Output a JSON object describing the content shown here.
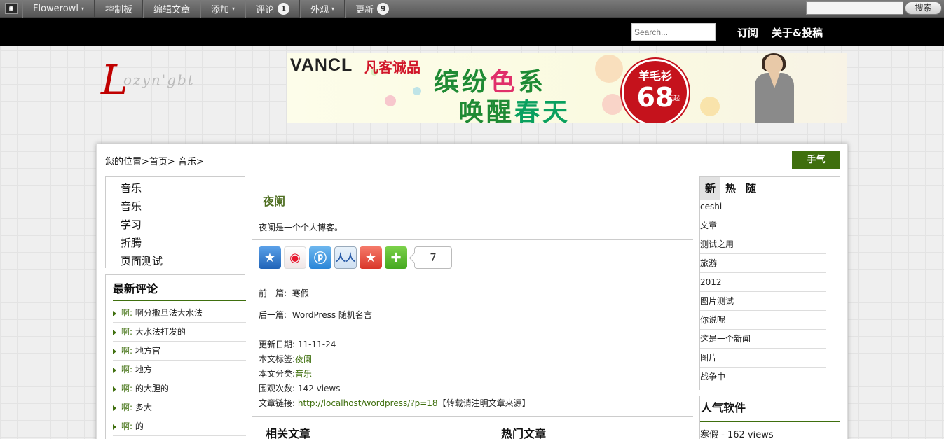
{
  "adminbar": {
    "items": [
      {
        "label": "Flowerowl",
        "caret": "▾"
      },
      {
        "label": "控制板"
      },
      {
        "label": "编辑文章"
      },
      {
        "label": "添加",
        "caret": "▾"
      },
      {
        "label": "评论",
        "count": "1"
      },
      {
        "label": "外观",
        "caret": "▾"
      },
      {
        "label": "更新",
        "count": "9"
      }
    ],
    "search_value": "",
    "search_button": "搜索"
  },
  "header": {
    "search_placeholder": "Search...",
    "links": [
      "订阅",
      "关于&投稿"
    ]
  },
  "logo": {
    "initial": "L",
    "rest": "ozyn'gbt"
  },
  "banner": {
    "brand": "VANCL",
    "brand_sub": "凡客诚品",
    "line1_a": "缤纷",
    "line1_b": "色",
    "line1_c": "系",
    "line2_a": "唤醒",
    "line2_b": "春天",
    "badge_title": "羊毛衫",
    "badge_price": "68",
    "badge_unit": "元起"
  },
  "breadcrumb": {
    "prefix": "您的位置>",
    "home": "首页",
    "sep": "> ",
    "cat": "音乐",
    "end": ">"
  },
  "phone_button": "手气",
  "categories": [
    "音乐",
    "音乐",
    "学习",
    "折腾",
    "页面测试"
  ],
  "recent_comments": {
    "title": "最新评论",
    "items": [
      {
        "who": "啊:",
        "text": " 啊分撒旦法大水法"
      },
      {
        "who": "啊:",
        "text": " 大水法打发的"
      },
      {
        "who": "啊:",
        "text": " 地方官"
      },
      {
        "who": "啊:",
        "text": " 地方"
      },
      {
        "who": "啊:",
        "text": " 的大胆的"
      },
      {
        "who": "啊:",
        "text": " 多大"
      },
      {
        "who": "啊:",
        "text": " 的"
      }
    ]
  },
  "post": {
    "title": "夜阑",
    "body": "夜阑是一个个人博客。",
    "share_count": "7",
    "prev_label": "前一篇:",
    "prev_title": "寒假",
    "next_label": "后一篇:",
    "next_title": "WordPress 随机名言",
    "meta": {
      "date_label": "更新日期:",
      "date": "11-11-24",
      "tag_label": "本文标签:",
      "tag": "夜阑",
      "cat_label": "本文分类:",
      "cat": "音乐",
      "views_label": "围观次数:",
      "views": "142 views",
      "link_label": "文章链接:",
      "link": "http://localhost/wordpress/?p=18",
      "link_note": "【转载请注明文章来源】"
    },
    "related_title": "相关文章",
    "hot_title": "热门文章"
  },
  "side_tabs": [
    "新",
    "热",
    "随"
  ],
  "side_list": [
    "ceshi",
    "文章",
    "测试之用",
    "旅游",
    "2012",
    "图片测试",
    "你说呢",
    "这是一个新闻",
    "图片",
    "战争中"
  ],
  "popular": {
    "title": "人气软件",
    "item": "寒假 - 162 views"
  },
  "colors": {
    "accent": "#3f6f0e",
    "title_green": "#4f6f22",
    "header_bg": "#000000"
  }
}
